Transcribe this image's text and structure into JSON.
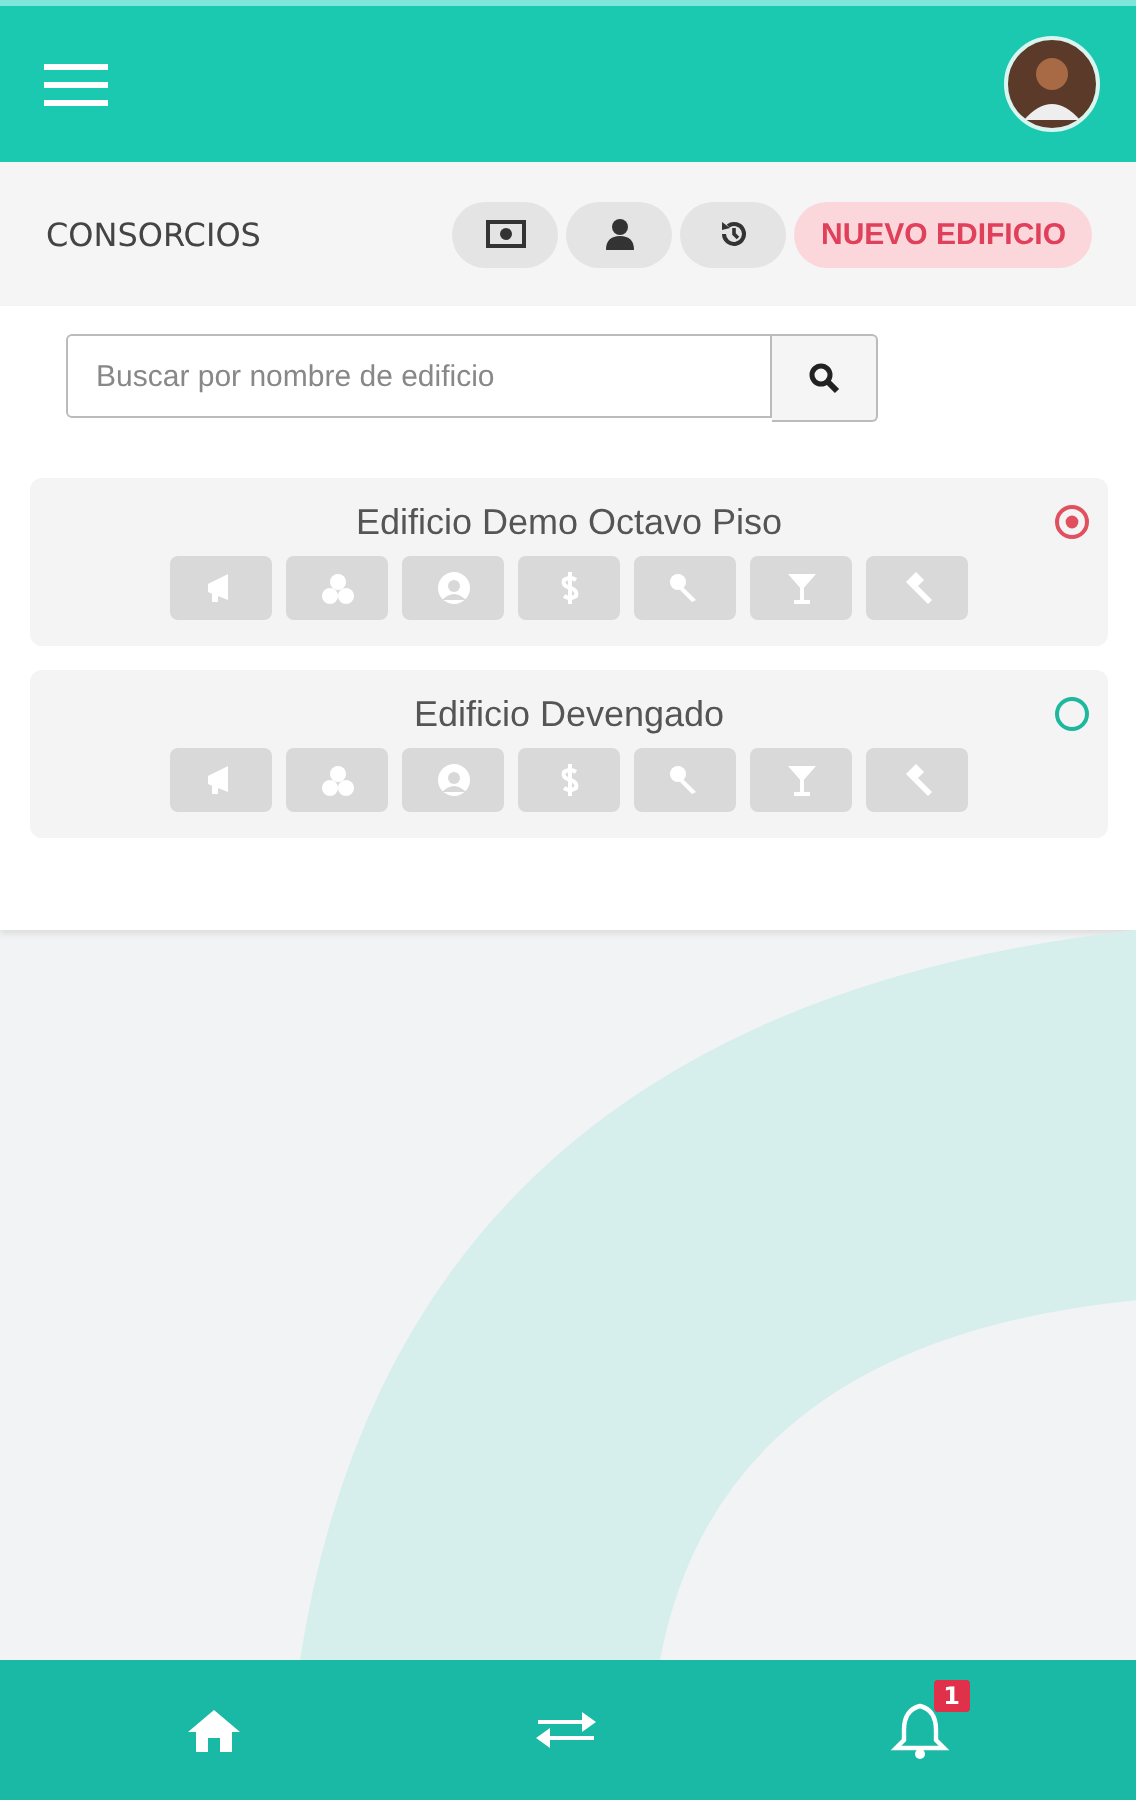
{
  "toolbar": {
    "title": "CONSORCIOS",
    "new_button": "NUEVO EDIFICIO"
  },
  "search": {
    "placeholder": "Buscar por nombre de edificio"
  },
  "buildings": [
    {
      "name": "Edificio Demo Octavo Piso",
      "selected": true
    },
    {
      "name": "Edificio Devengado",
      "selected": false
    }
  ],
  "bottom_nav": {
    "notification_count": "1"
  }
}
